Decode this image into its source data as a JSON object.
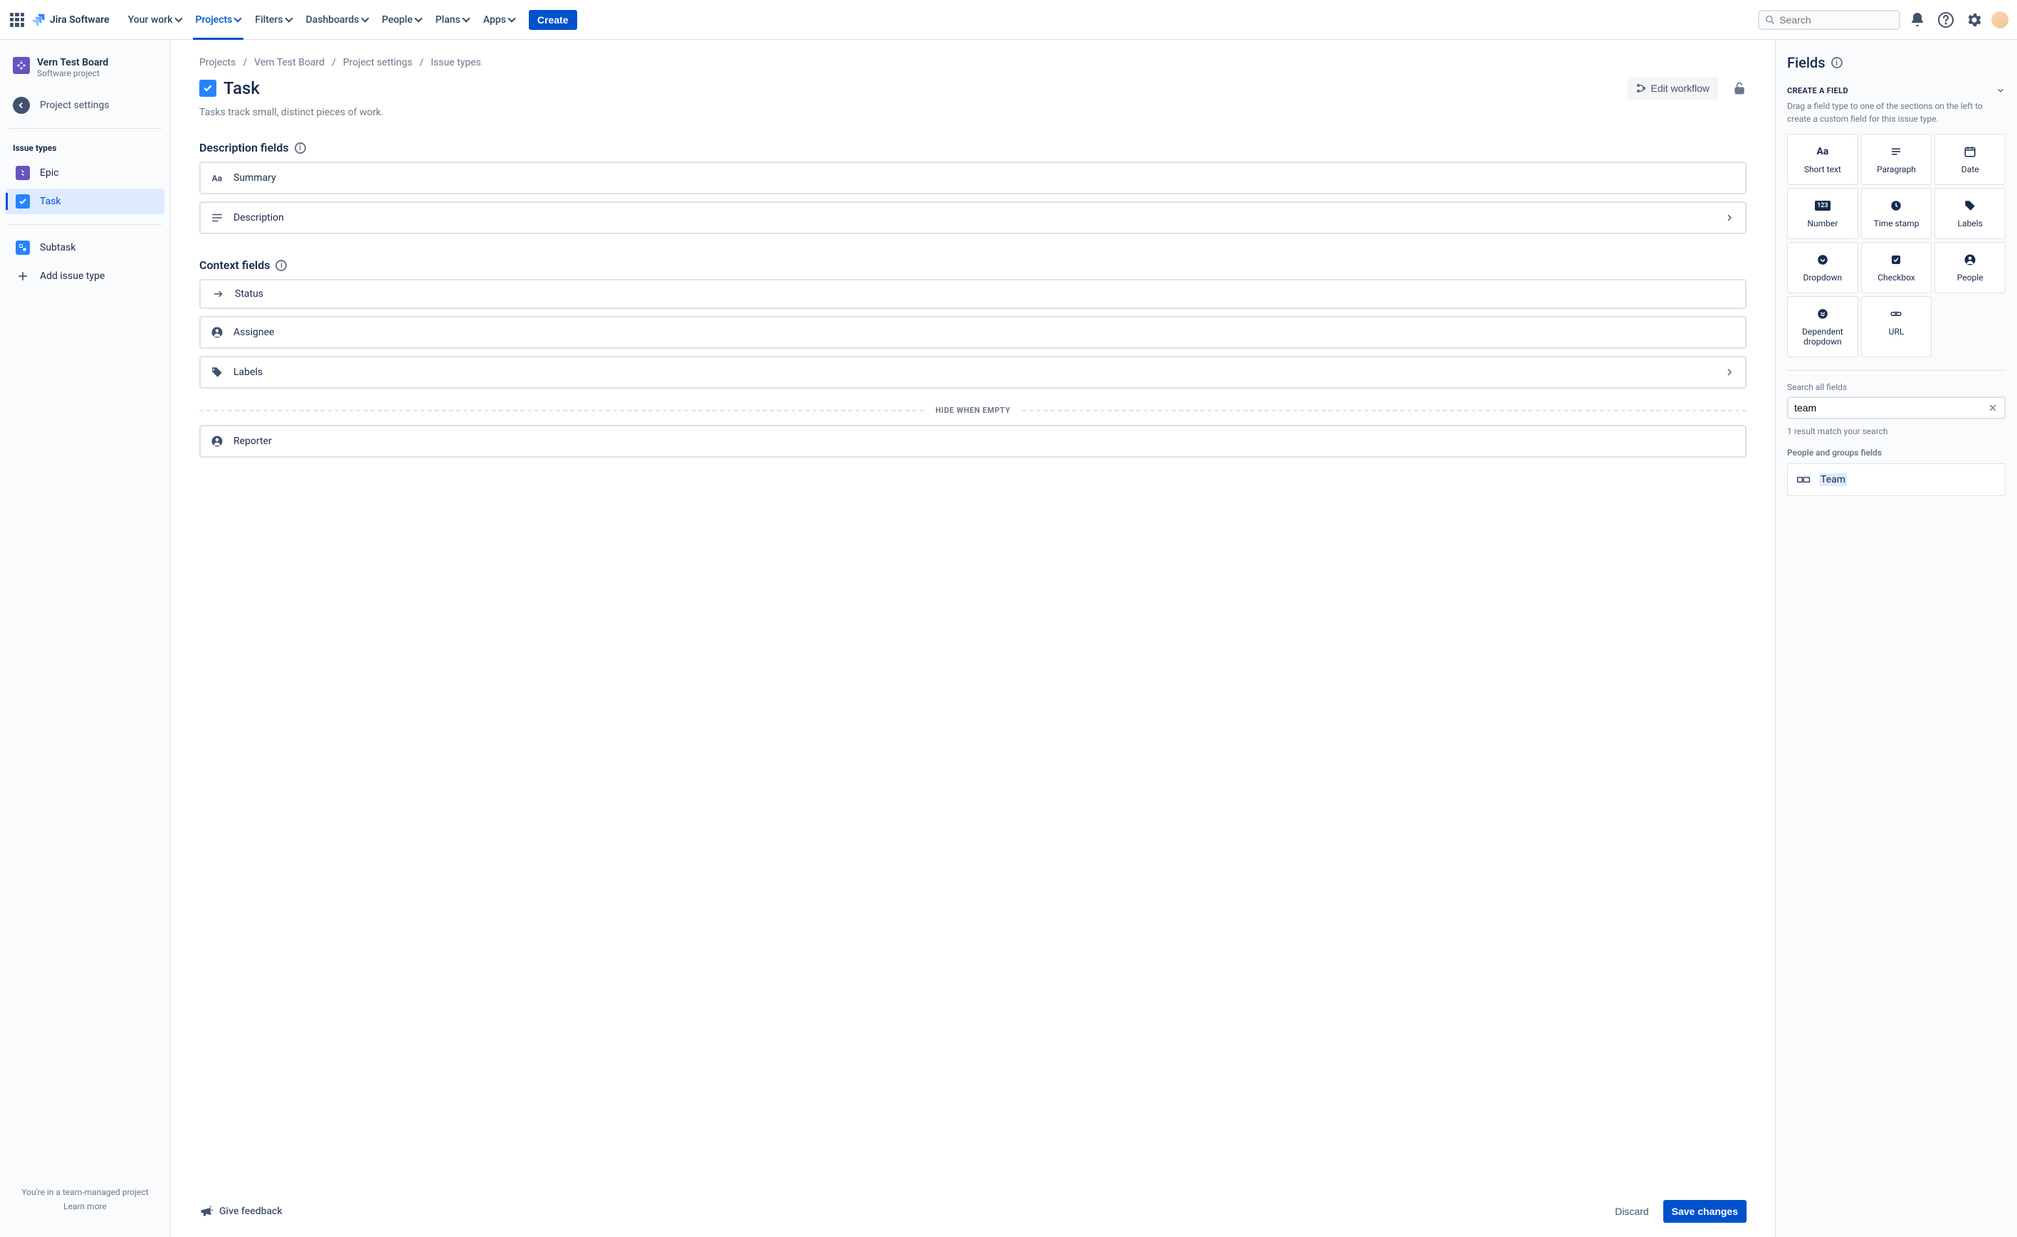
{
  "topnav": {
    "logo": "Jira Software",
    "links": [
      "Your work",
      "Projects",
      "Filters",
      "Dashboards",
      "People",
      "Plans",
      "Apps"
    ],
    "active_index": 1,
    "create": "Create",
    "search_placeholder": "Search"
  },
  "sidebar": {
    "project_name": "Vern Test Board",
    "project_type": "Software project",
    "settings_link": "Project settings",
    "section_heading": "Issue types",
    "items": [
      {
        "label": "Epic"
      },
      {
        "label": "Task"
      },
      {
        "label": "Subtask"
      }
    ],
    "add_label": "Add issue type",
    "footer_hint": "You're in a team-managed project",
    "footer_link": "Learn more"
  },
  "breadcrumbs": [
    "Projects",
    "Vern Test Board",
    "Project settings",
    "Issue types"
  ],
  "page": {
    "title": "Task",
    "edit_workflow": "Edit workflow",
    "desc": "Tasks track small, distinct pieces of work.",
    "desc_section": "Description fields",
    "context_section": "Context fields",
    "hide_label": "HIDE WHEN EMPTY",
    "fields_desc": [
      {
        "label": "Summary"
      },
      {
        "label": "Description"
      }
    ],
    "fields_ctx": [
      {
        "label": "Status"
      },
      {
        "label": "Assignee"
      },
      {
        "label": "Labels"
      }
    ],
    "fields_hidden": [
      {
        "label": "Reporter"
      }
    ],
    "feedback": "Give feedback",
    "discard": "Discard",
    "save": "Save changes"
  },
  "rpanel": {
    "title": "Fields",
    "create_heading": "CREATE A FIELD",
    "create_hint": "Drag a field type to one of the sections on the left to create a custom field for this issue type.",
    "field_types": [
      "Short text",
      "Paragraph",
      "Date",
      "Number",
      "Time stamp",
      "Labels",
      "Dropdown",
      "Checkbox",
      "People",
      "Dependent dropdown",
      "URL"
    ],
    "search_label": "Search all fields",
    "search_value": "team",
    "result_text": "1 result match your search",
    "group_heading": "People and groups fields",
    "result_item": "Team"
  }
}
